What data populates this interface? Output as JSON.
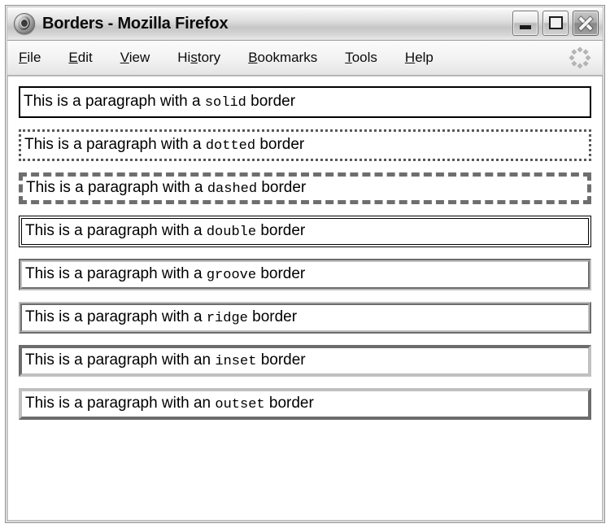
{
  "window": {
    "title": "Borders - Mozilla Firefox",
    "app_icon": "firefox-logo-icon",
    "buttons": {
      "minimize_label": "Minimize",
      "maximize_label": "Maximize",
      "close_label": "Close"
    }
  },
  "menu_bar": {
    "items": [
      {
        "label": "File",
        "accel_before": "",
        "accel": "F",
        "accel_after": "ile"
      },
      {
        "label": "Edit",
        "accel_before": "",
        "accel": "E",
        "accel_after": "dit"
      },
      {
        "label": "View",
        "accel_before": "",
        "accel": "V",
        "accel_after": "iew"
      },
      {
        "label": "History",
        "accel_before": "Hi",
        "accel": "s",
        "accel_after": "tory"
      },
      {
        "label": "Bookmarks",
        "accel_before": "",
        "accel": "B",
        "accel_after": "ookmarks"
      },
      {
        "label": "Tools",
        "accel_before": "",
        "accel": "T",
        "accel_after": "ools"
      },
      {
        "label": "Help",
        "accel_before": "",
        "accel": "H",
        "accel_after": "elp"
      }
    ],
    "throbber": "throbber-icon"
  },
  "page": {
    "paragraphs": [
      {
        "lead": "This is a paragraph with a ",
        "style_name": "solid",
        "tail": " border",
        "border_style": "solid"
      },
      {
        "lead": "This is a paragraph with a ",
        "style_name": "dotted",
        "tail": " border",
        "border_style": "dotted"
      },
      {
        "lead": "This is a paragraph with a ",
        "style_name": "dashed",
        "tail": " border",
        "border_style": "dashed"
      },
      {
        "lead": "This is a paragraph with a ",
        "style_name": "double",
        "tail": " border",
        "border_style": "double"
      },
      {
        "lead": "This is a paragraph with a ",
        "style_name": "groove",
        "tail": " border",
        "border_style": "groove"
      },
      {
        "lead": "This is a paragraph with a ",
        "style_name": "ridge",
        "tail": " border",
        "border_style": "ridge"
      },
      {
        "lead": "This is a paragraph with an ",
        "style_name": "inset",
        "tail": " border",
        "border_style": "inset"
      },
      {
        "lead": "This is a paragraph with an ",
        "style_name": "outset",
        "tail": " border",
        "border_style": "outset"
      }
    ]
  },
  "colors": {
    "title_text": "#0a0a0a",
    "page_background": "#ffffff",
    "chrome_background": "#e8e8e8",
    "border_black": "#000000",
    "border_gray": "#6e6e6e",
    "bevel_gray": "#c0c0c0"
  }
}
